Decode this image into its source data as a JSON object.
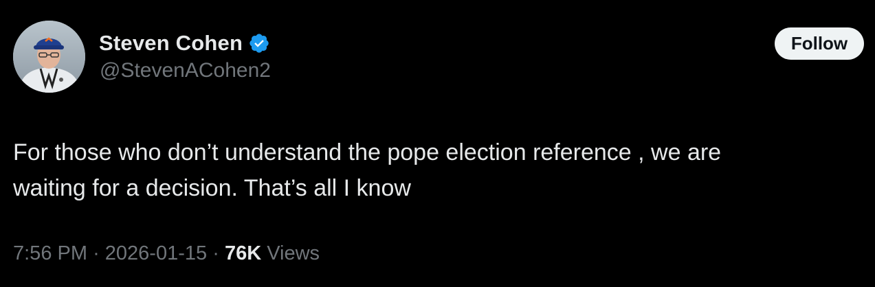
{
  "author": {
    "display_name": "Steven Cohen",
    "handle": "@StevenACohen2",
    "verified_icon": "verified-badge-icon",
    "avatar_icon": "profile-photo"
  },
  "actions": {
    "follow_label": "Follow"
  },
  "tweet": {
    "text_lines": [
      "For those who don’t understand the pope election reference , we are",
      "waiting for a decision. That’s all I know"
    ]
  },
  "meta": {
    "time": "7:56 PM",
    "separator": "·",
    "date": "2026-01-15",
    "views_count": "76K",
    "views_label": "Views"
  },
  "colors": {
    "background": "#000000",
    "primary_text": "#e7e9ea",
    "secondary_text": "#71767b",
    "verified_blue": "#1d9bf0",
    "follow_button_bg": "#eff3f4"
  }
}
